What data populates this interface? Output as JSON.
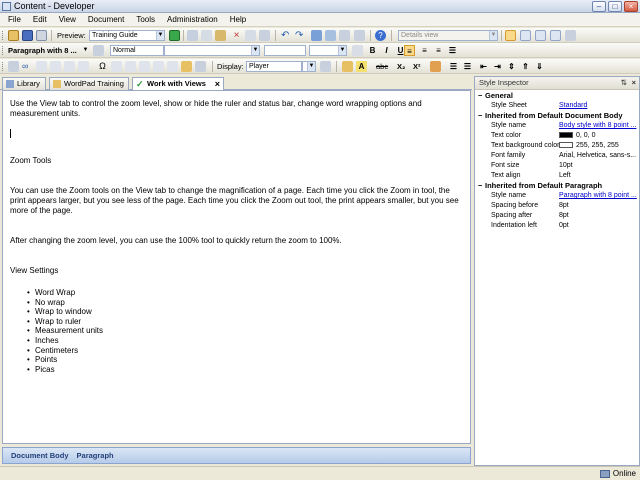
{
  "window": {
    "title": "Content - Developer"
  },
  "menu": [
    "File",
    "Edit",
    "View",
    "Document",
    "Tools",
    "Administration",
    "Help"
  ],
  "toolbar1": {
    "preview_label": "Preview:",
    "preview_value": "Training Guide",
    "view_value": "Details view"
  },
  "toolbar2": {
    "paragraph_style": "Paragraph with 8 ...",
    "char_style": "Normal",
    "bold": "B",
    "italic": "I",
    "underline": "U"
  },
  "toolbar3": {
    "display_label": "Display:",
    "display_value": "Player",
    "abc": "abc",
    "subscript": "X₂",
    "superscript": "X²"
  },
  "tabs": [
    {
      "label": "Library"
    },
    {
      "label": "WordPad Training"
    },
    {
      "label": "Work with Views"
    }
  ],
  "document": {
    "intro": "Use the View tab to control the zoom level, show or hide the ruler and status bar, change word wrapping options and measurement units.",
    "heading_zoom": "Zoom Tools",
    "zoom_text": "You can use the Zoom tools on the View tab to change the magnification of a page. Each time you click the Zoom in tool, the print appears larger, but you see less of the page. Each time you click the Zoom out tool, the print appears smaller, but you see more of the page.",
    "zoom_reset": "After changing the zoom level, you can use the 100% tool to quickly return the zoom to 100%.",
    "heading_view": "View Settings",
    "bullets": [
      "Word Wrap",
      "No wrap",
      "Wrap to window",
      "Wrap to ruler",
      "Measurement units",
      "Inches",
      "Centimeters",
      "Points",
      "Picas"
    ]
  },
  "doc_status": {
    "body": "Document Body",
    "paragraph": "Paragraph"
  },
  "inspector": {
    "title": "Style Inspector",
    "general": {
      "heading": "General",
      "style_sheet_label": "Style Sheet",
      "style_sheet_value": "Standard"
    },
    "doc_body": {
      "heading": "Inherited from Default Document Body",
      "rows": [
        {
          "k": "Style name",
          "v": "Body style with 8 point ..."
        },
        {
          "k": "Text color",
          "v": "0, 0, 0"
        },
        {
          "k": "Text background color",
          "v": "255, 255, 255"
        },
        {
          "k": "Font family",
          "v": "Arial, Helvetica, sans-s..."
        },
        {
          "k": "Font size",
          "v": "10pt"
        },
        {
          "k": "Text align",
          "v": "Left"
        }
      ]
    },
    "paragraph": {
      "heading": "Inherited from Default Paragraph",
      "rows": [
        {
          "k": "Style name",
          "v": "Paragraph with 8 point ..."
        },
        {
          "k": "Spacing before",
          "v": "8pt"
        },
        {
          "k": "Spacing after",
          "v": "8pt"
        },
        {
          "k": "Indentation left",
          "v": "0pt"
        }
      ]
    }
  },
  "status": {
    "online": "Online"
  },
  "colors": {
    "text_color_swatch": "#000000",
    "bg_color_swatch": "#ffffff",
    "accent": "#316ac5"
  }
}
